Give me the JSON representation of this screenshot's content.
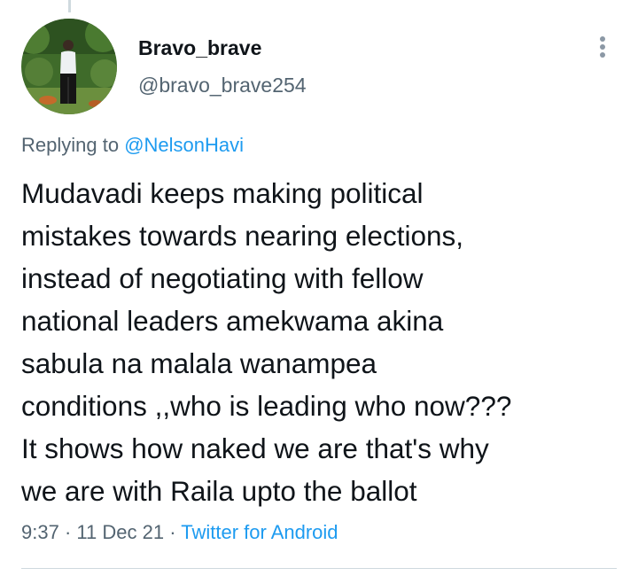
{
  "tweet": {
    "author": {
      "display_name": "Bravo_brave",
      "handle": "@bravo_brave254",
      "avatar": "profile-photo"
    },
    "menu_icon": "more-vertical-icon",
    "replying_to": {
      "label": "Replying to",
      "mention": "@NelsonHavi"
    },
    "text": "Mudavadi keeps making political\nmistakes towards nearing elections,\ninstead of negotiating with fellow\nnational leaders amekwama akina\nsabula na malala wanampea\nconditions ,,who is leading who now???\nIt shows how naked we are that's why\nwe are with Raila upto the ballot",
    "time": "9:37",
    "date": "11 Dec 21",
    "separator": "·",
    "source": "Twitter for Android"
  },
  "colors": {
    "text_primary": "#0f1419",
    "text_secondary": "#536471",
    "link": "#1d9bf0",
    "divider": "#cfd9de"
  }
}
